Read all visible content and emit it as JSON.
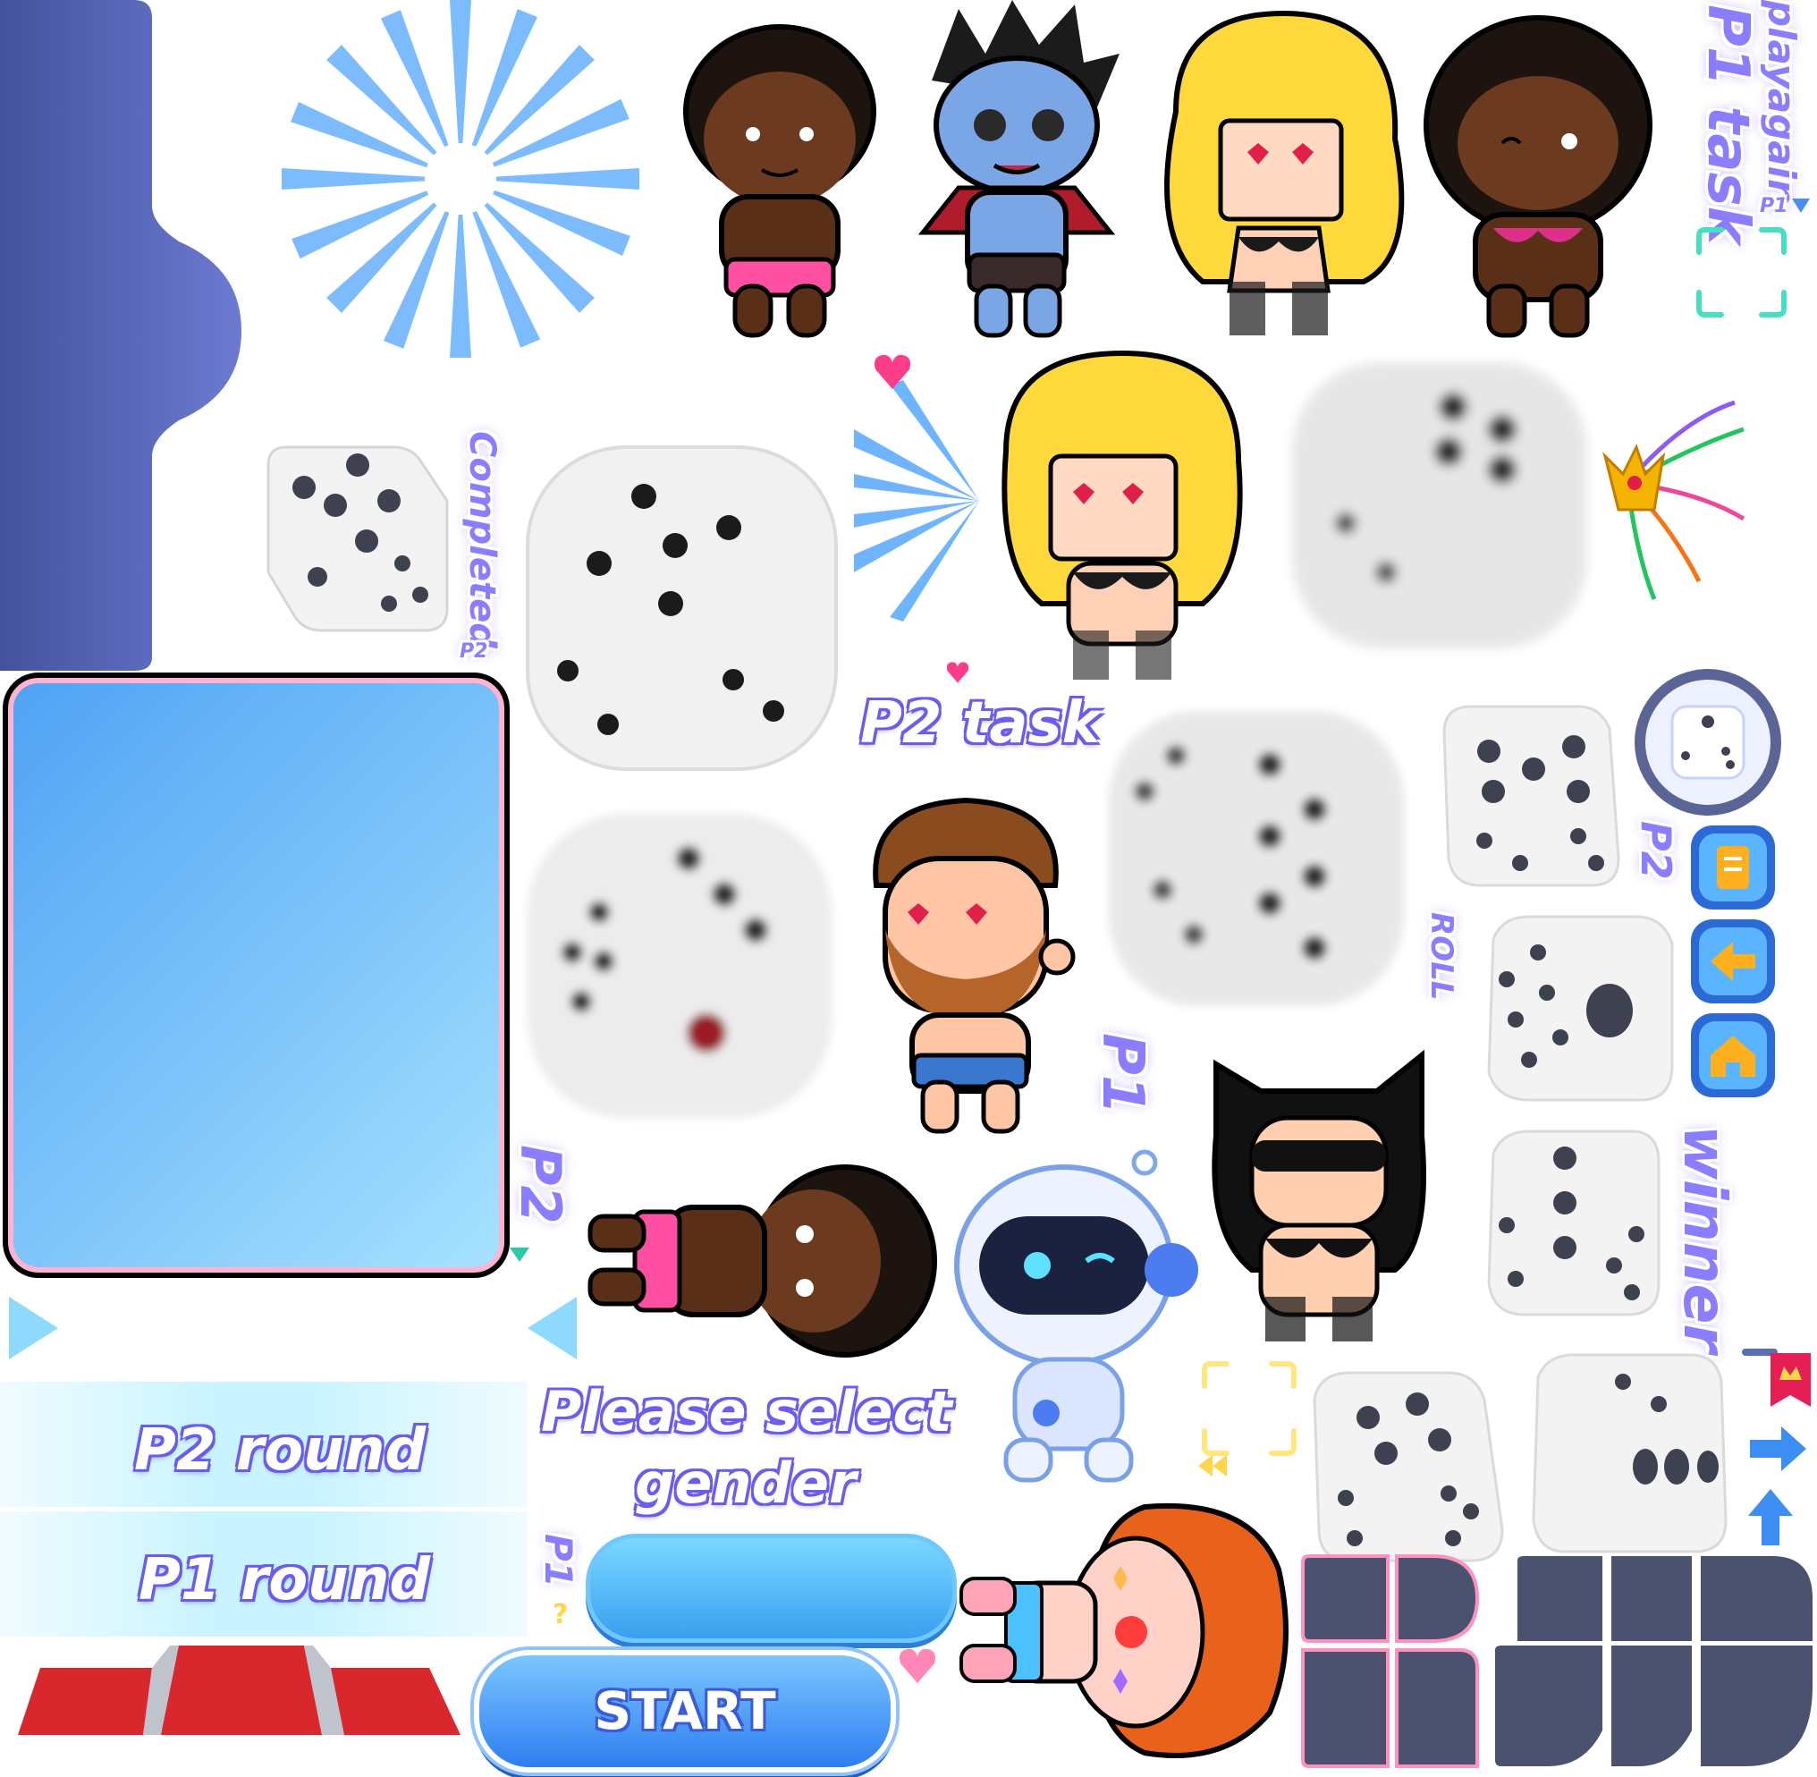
{
  "labels": {
    "play_again": "playagain",
    "p1_task": "P1 task",
    "p1_small": "P1",
    "completed": "Completed",
    "p2_small": "P2",
    "p2_task": "P2 task",
    "p2_side": "P2",
    "roll": "ROLL",
    "p1_side": "P1",
    "winner": "winner",
    "p2_marker": "P2",
    "please_select_line1": "Please select",
    "please_select_line2": "gender",
    "p2_round": "P2 round",
    "p1_round": "P1 round",
    "p1_question": "P1",
    "start": "START"
  },
  "colors": {
    "panel_dark": "#4a58a8",
    "panel_blue_top": "#58a6ff",
    "panel_blue_bottom": "#a6e0ff",
    "label_purple": "#8a7dff",
    "button_blue": "#3fa7f5",
    "dark_tile": "#4b5270",
    "red_stripe": "#d9272e"
  },
  "icons": {
    "button_1": "note-icon",
    "button_2": "back-arrow-icon",
    "button_3": "home-icon",
    "flag": "crown-flag-icon",
    "arrow_right": "arrow-right-icon",
    "arrow_up": "arrow-up-icon",
    "heart": "heart-icon",
    "crown": "crown-icon"
  }
}
